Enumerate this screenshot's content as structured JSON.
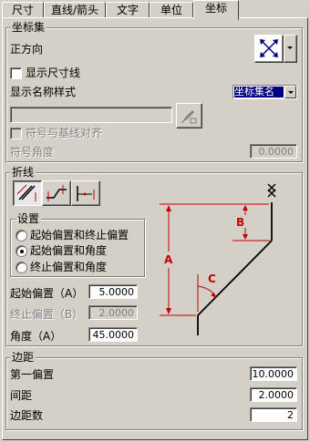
{
  "tabs": [
    "尺寸",
    "直线/箭头",
    "文字",
    "单位",
    "坐标"
  ],
  "coord_set": {
    "title": "坐标集",
    "orientation_label": "正方向",
    "show_dimension_line_label": "显示尺寸线",
    "show_name_style_label": "显示名称样式",
    "name_style_value": "坐标集名",
    "name_field_value": "",
    "align_symbol_label": "符号与基线对齐",
    "symbol_angle_label": "符号角度",
    "symbol_angle_value": "0.0000"
  },
  "jog": {
    "title": "折线",
    "settings_title": "设置",
    "options": [
      "起始偏置和终止偏置",
      "起始偏置和角度",
      "终止偏置和角度"
    ],
    "selected_option": 1,
    "start_offset_label": "起始偏置（A）",
    "start_offset_value": "5.0000",
    "end_offset_label": "终止偏置（B）",
    "end_offset_value": "2.0000",
    "angle_label": "角度（A）",
    "angle_value": "45.0000",
    "diagram_labels": [
      "A",
      "B",
      "C"
    ]
  },
  "margin": {
    "title": "边距",
    "first_offset_label": "第一偏置",
    "first_offset_value": "10.0000",
    "spacing_label": "间距",
    "spacing_value": "2.0000",
    "margin_count_label": "边距数",
    "margin_count_value": "2"
  },
  "colors": {
    "dimension_red": "#c00000",
    "selection_blue": "#000080",
    "dark": "#000000"
  }
}
